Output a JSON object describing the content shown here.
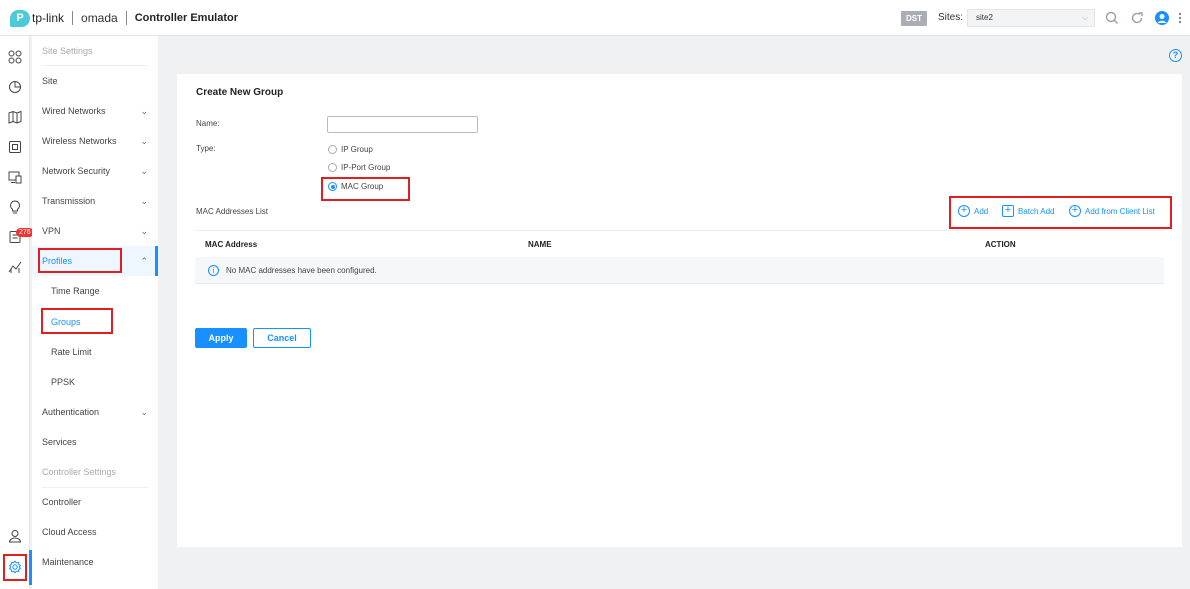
{
  "header": {
    "brand": "tp-link",
    "product": "omada",
    "title": "Controller Emulator",
    "dst_badge": "DST",
    "sites_label": "Sites",
    "site_value": "site2"
  },
  "rail": {
    "badge": "276"
  },
  "sidebar": {
    "section_site": "Site Settings",
    "items": [
      {
        "label": "Site"
      },
      {
        "label": "Wired Networks"
      },
      {
        "label": "Wireless Networks"
      },
      {
        "label": "Network Security"
      },
      {
        "label": "Transmission"
      },
      {
        "label": "VPN"
      },
      {
        "label": "Profiles"
      },
      {
        "label": "Time Range"
      },
      {
        "label": "Groups"
      },
      {
        "label": "Rate Limit"
      },
      {
        "label": "PPSK"
      },
      {
        "label": "Authentication"
      },
      {
        "label": "Services"
      }
    ],
    "section_controller": "Controller Settings",
    "controller_items": [
      {
        "label": "Controller"
      },
      {
        "label": "Cloud Access"
      },
      {
        "label": "Maintenance"
      }
    ]
  },
  "form": {
    "title": "Create New Group",
    "name_label": "Name:",
    "name_value": "",
    "type_label": "Type:",
    "types": [
      {
        "label": "IP Group",
        "selected": false
      },
      {
        "label": "IP-Port Group",
        "selected": false
      },
      {
        "label": "MAC Group",
        "selected": true
      }
    ],
    "list_label": "MAC Addresses List",
    "actions": {
      "add": "Add",
      "batch_add": "Batch Add",
      "add_from_client": "Add from Client List"
    },
    "columns": [
      "MAC Address",
      "NAME",
      "ACTION"
    ],
    "empty_message": "No MAC addresses have been configured.",
    "apply": "Apply",
    "cancel": "Cancel"
  },
  "colors": {
    "accent": "#1890ff",
    "highlight": "#e02020"
  }
}
